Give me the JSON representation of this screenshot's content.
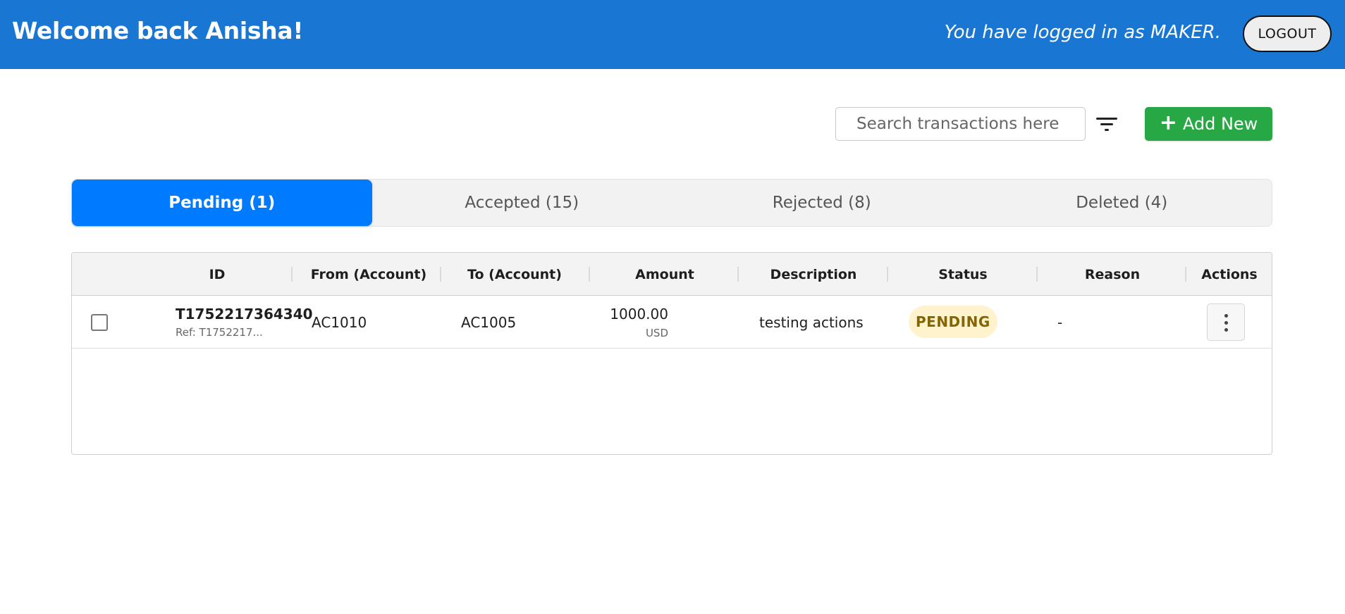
{
  "header": {
    "welcome": "Welcome back Anisha!",
    "role_text": "You have logged in as MAKER.",
    "logout_label": "LOGOUT",
    "color": "#1976d2"
  },
  "toolbar": {
    "search_placeholder": "Search transactions here",
    "filter_icon": "filter-list-icon",
    "add_new_icon": "+",
    "add_new_label": "Add New",
    "add_new_color": "#28a745"
  },
  "tabs": [
    {
      "label": "Pending (1)",
      "active": true
    },
    {
      "label": "Accepted (15)",
      "active": false
    },
    {
      "label": "Rejected (8)",
      "active": false
    },
    {
      "label": "Deleted (4)",
      "active": false
    }
  ],
  "table": {
    "columns": [
      "ID",
      "From (Account)",
      "To (Account)",
      "Amount",
      "Description",
      "Status",
      "Reason",
      "Actions"
    ],
    "rows": [
      {
        "selected": false,
        "id": "T1752217364340",
        "ref": "Ref: T1752217...",
        "from": "AC1010",
        "to": "AC1005",
        "amount": "1000.00",
        "currency": "USD",
        "description": "testing actions",
        "status": "PENDING",
        "reason": "-",
        "actions_icon": "more-vertical-icon"
      }
    ]
  }
}
